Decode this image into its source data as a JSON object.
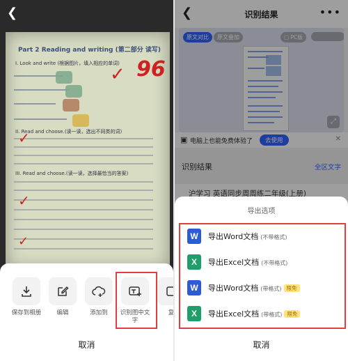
{
  "left": {
    "worksheet": {
      "header": "Part 2 Reading and writing (第二部分 读写)",
      "section_1": "I. Look and write (根据图片，填入相应的单词)",
      "section_2": "II. Read and choose.(读一读，选出不同类的词)",
      "section_3": "III. Read and choose.(读一读，选择最恰当的答案)",
      "score": "96"
    },
    "actions": [
      {
        "label": "保存到相册"
      },
      {
        "label": "编辑"
      },
      {
        "label": "添加到"
      },
      {
        "label": "识别图中文字"
      },
      {
        "label": "复"
      }
    ],
    "cancel_label": "取消"
  },
  "right": {
    "title": "识别结果",
    "preview_tabs": {
      "active": "原文对比",
      "inactive": "原文叠加"
    },
    "pc_label": "PC版",
    "promo": {
      "text": "电脑上也能免费体验了",
      "button": "去使用"
    },
    "section": {
      "title": "识别结果",
      "full_text_label": "全区文字",
      "first_line": "沪学习 英语同步周周练二年级(上册)"
    },
    "export": {
      "title": "导出选项",
      "items": [
        {
          "main": "导出Word文档",
          "sub": "(不带格式)",
          "badge": ""
        },
        {
          "main": "导出Excel文档",
          "sub": "(不带格式)",
          "badge": ""
        },
        {
          "main": "导出Word文档",
          "sub": "(带格式)",
          "badge": "限免"
        },
        {
          "main": "导出Excel文档",
          "sub": "(带格式)",
          "badge": "限免"
        }
      ],
      "cancel_label": "取消"
    }
  },
  "colors": {
    "accent_blue": "#2f64ff",
    "highlight_red": "#e0403a",
    "word_blue": "#2b5cd6",
    "excel_green": "#1f9e6a"
  }
}
